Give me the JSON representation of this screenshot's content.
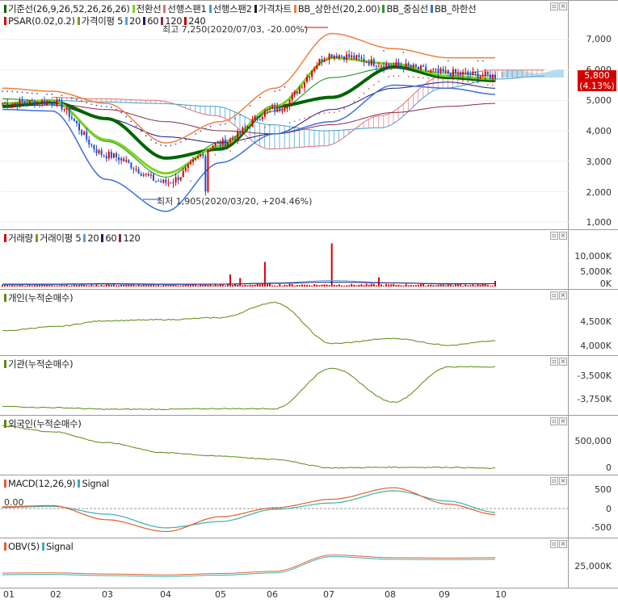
{
  "colors": {
    "up": "#d60000",
    "down": "#1e4fd0",
    "kijun": "#006400",
    "tenkan": "#7ed321",
    "senkou1": "#e07070",
    "senkou2": "#3f9fd0",
    "bb_upper": "#f0803c",
    "bb_mid": "#2f9b2f",
    "bb_lower": "#3b6fe0",
    "psar": "#3050c0",
    "ma5": "#7a9a2a",
    "ma20": "#5aa0e0",
    "ma60": "#1a1a7a",
    "ma120": "#8a2a4a",
    "volume": "#d60000",
    "flow": "#5a8a10",
    "macd": "#e0602a",
    "signal": "#3ab0b0",
    "obv": "#e0602a"
  },
  "price_panel": {
    "legend": [
      {
        "label": "기준선(26,9,26,52,26,26,26)",
        "color": "#006400"
      },
      {
        "label": "전환선",
        "color": "#7ed321"
      },
      {
        "label": "선행스팬1",
        "color": "#e07070"
      },
      {
        "label": "선행스팬2",
        "color": "#3f9fd0"
      },
      {
        "label": "가격차트",
        "color": "#222222"
      },
      {
        "label": "BB_상한선(20,2.00)",
        "color": "#f0803c"
      },
      {
        "label": "BB_중심선",
        "color": "#2f9b2f"
      },
      {
        "label": "BB_하한선",
        "color": "#3b6fe0"
      }
    ],
    "legend2": [
      {
        "label": "PSAR(0.02,0.2)",
        "color": "#d60000"
      },
      {
        "label": "가격이평 5",
        "color": "#7a9a2a"
      },
      {
        "label": "20",
        "color": "#5aa0e0"
      },
      {
        "label": "60",
        "color": "#1a1a7a"
      },
      {
        "label": "120",
        "color": "#8a2a4a"
      },
      {
        "label": "240",
        "color": "#c00000"
      }
    ],
    "ticks": [
      "7,000",
      "6,000",
      "5,000",
      "4,000",
      "3,000",
      "2,000",
      "1,000"
    ],
    "last_price": "5,800",
    "last_change": "(4.13%)",
    "high_note": "최고 7,250(2020/07/03, -20.00%)",
    "low_note": "최저 1,905(2020/03/20, +204.46%)"
  },
  "volume_panel": {
    "legend": [
      {
        "label": "거래량",
        "color": "#d60000"
      },
      {
        "label": "거래이평 5",
        "color": "#7a9a2a"
      },
      {
        "label": "20",
        "color": "#5aa0e0"
      },
      {
        "label": "60",
        "color": "#1a1a7a"
      },
      {
        "label": "120",
        "color": "#8a2a4a"
      }
    ],
    "ticks": [
      "10,000K",
      "5,000K",
      "0K"
    ]
  },
  "individual_panel": {
    "legend": "개인(누적순매수)",
    "ticks": [
      "4,500K",
      "4,000K"
    ]
  },
  "institution_panel": {
    "legend": "기관(누적순매수)",
    "ticks": [
      "-3,500K",
      "-3,750K"
    ]
  },
  "foreign_panel": {
    "legend": "외국인(누적순매수)",
    "ticks": [
      "500,000",
      "0"
    ]
  },
  "macd_panel": {
    "legend": [
      {
        "label": "MACD(12,26,9)",
        "color": "#e0602a"
      },
      {
        "label": "Signal",
        "color": "#3ab0b0"
      }
    ],
    "ticks": [
      "500",
      "0",
      "-500"
    ],
    "zero_label": "0.00"
  },
  "obv_panel": {
    "legend": [
      {
        "label": "OBV(5)",
        "color": "#e0602a"
      },
      {
        "label": "Signal",
        "color": "#3ab0b0"
      }
    ],
    "ticks": [
      "25,000K"
    ]
  },
  "x_axis": [
    "01",
    "02",
    "03",
    "04",
    "05",
    "06",
    "07",
    "08",
    "09",
    "10"
  ],
  "chart_data": {
    "type": "line",
    "title": "",
    "x": [
      "01",
      "02",
      "03",
      "04",
      "05",
      "06",
      "07",
      "08",
      "09",
      "10"
    ],
    "series": [
      {
        "name": "가격차트",
        "values": [
          4900,
          4950,
          3200,
          2700,
          3700,
          4600,
          6500,
          6200,
          5900,
          5800
        ]
      },
      {
        "name": "BB_상한선",
        "values": [
          5400,
          5300,
          4800,
          3400,
          4300,
          5200,
          7100,
          6700,
          6400,
          6400
        ]
      },
      {
        "name": "BB_하한선",
        "values": [
          4700,
          4700,
          2500,
          1400,
          3000,
          3900,
          4300,
          5600,
          5500,
          5200
        ]
      },
      {
        "name": "기준선",
        "values": [
          4800,
          4900,
          4000,
          3000,
          3500,
          4800,
          5200,
          6000,
          5800,
          5700
        ]
      },
      {
        "name": "개인(누적순매수)",
        "values": [
          4300,
          4400,
          4550,
          4520,
          4560,
          4850,
          4100,
          4150,
          4050,
          4100
        ]
      },
      {
        "name": "기관(누적순매수)",
        "values": [
          -3830,
          -3850,
          -3860,
          -3860,
          -3860,
          -3860,
          -3500,
          -3800,
          -3480,
          -3480
        ]
      },
      {
        "name": "외국인(누적순매수)",
        "values": [
          780000,
          650000,
          450000,
          280000,
          250000,
          200000,
          50000,
          50000,
          50000,
          30000
        ]
      },
      {
        "name": "MACD(12,26,9)",
        "values": [
          50,
          80,
          -300,
          -600,
          -200,
          20,
          200,
          550,
          100,
          -150
        ]
      },
      {
        "name": "OBV(5)",
        "values": [
          22000,
          22000,
          21500,
          21000,
          21500,
          22500,
          29500,
          28500,
          28500,
          28500
        ]
      }
    ],
    "ylim_price": [
      1000,
      7500
    ],
    "high": {
      "value": 7250,
      "date": "2020/07/03"
    },
    "low": {
      "value": 1905,
      "date": "2020/03/20"
    },
    "volume_spikes": [
      {
        "x": "06",
        "value": 6000
      },
      {
        "x": "07",
        "value": 10500
      },
      {
        "x": "05",
        "value": 3000
      }
    ]
  }
}
